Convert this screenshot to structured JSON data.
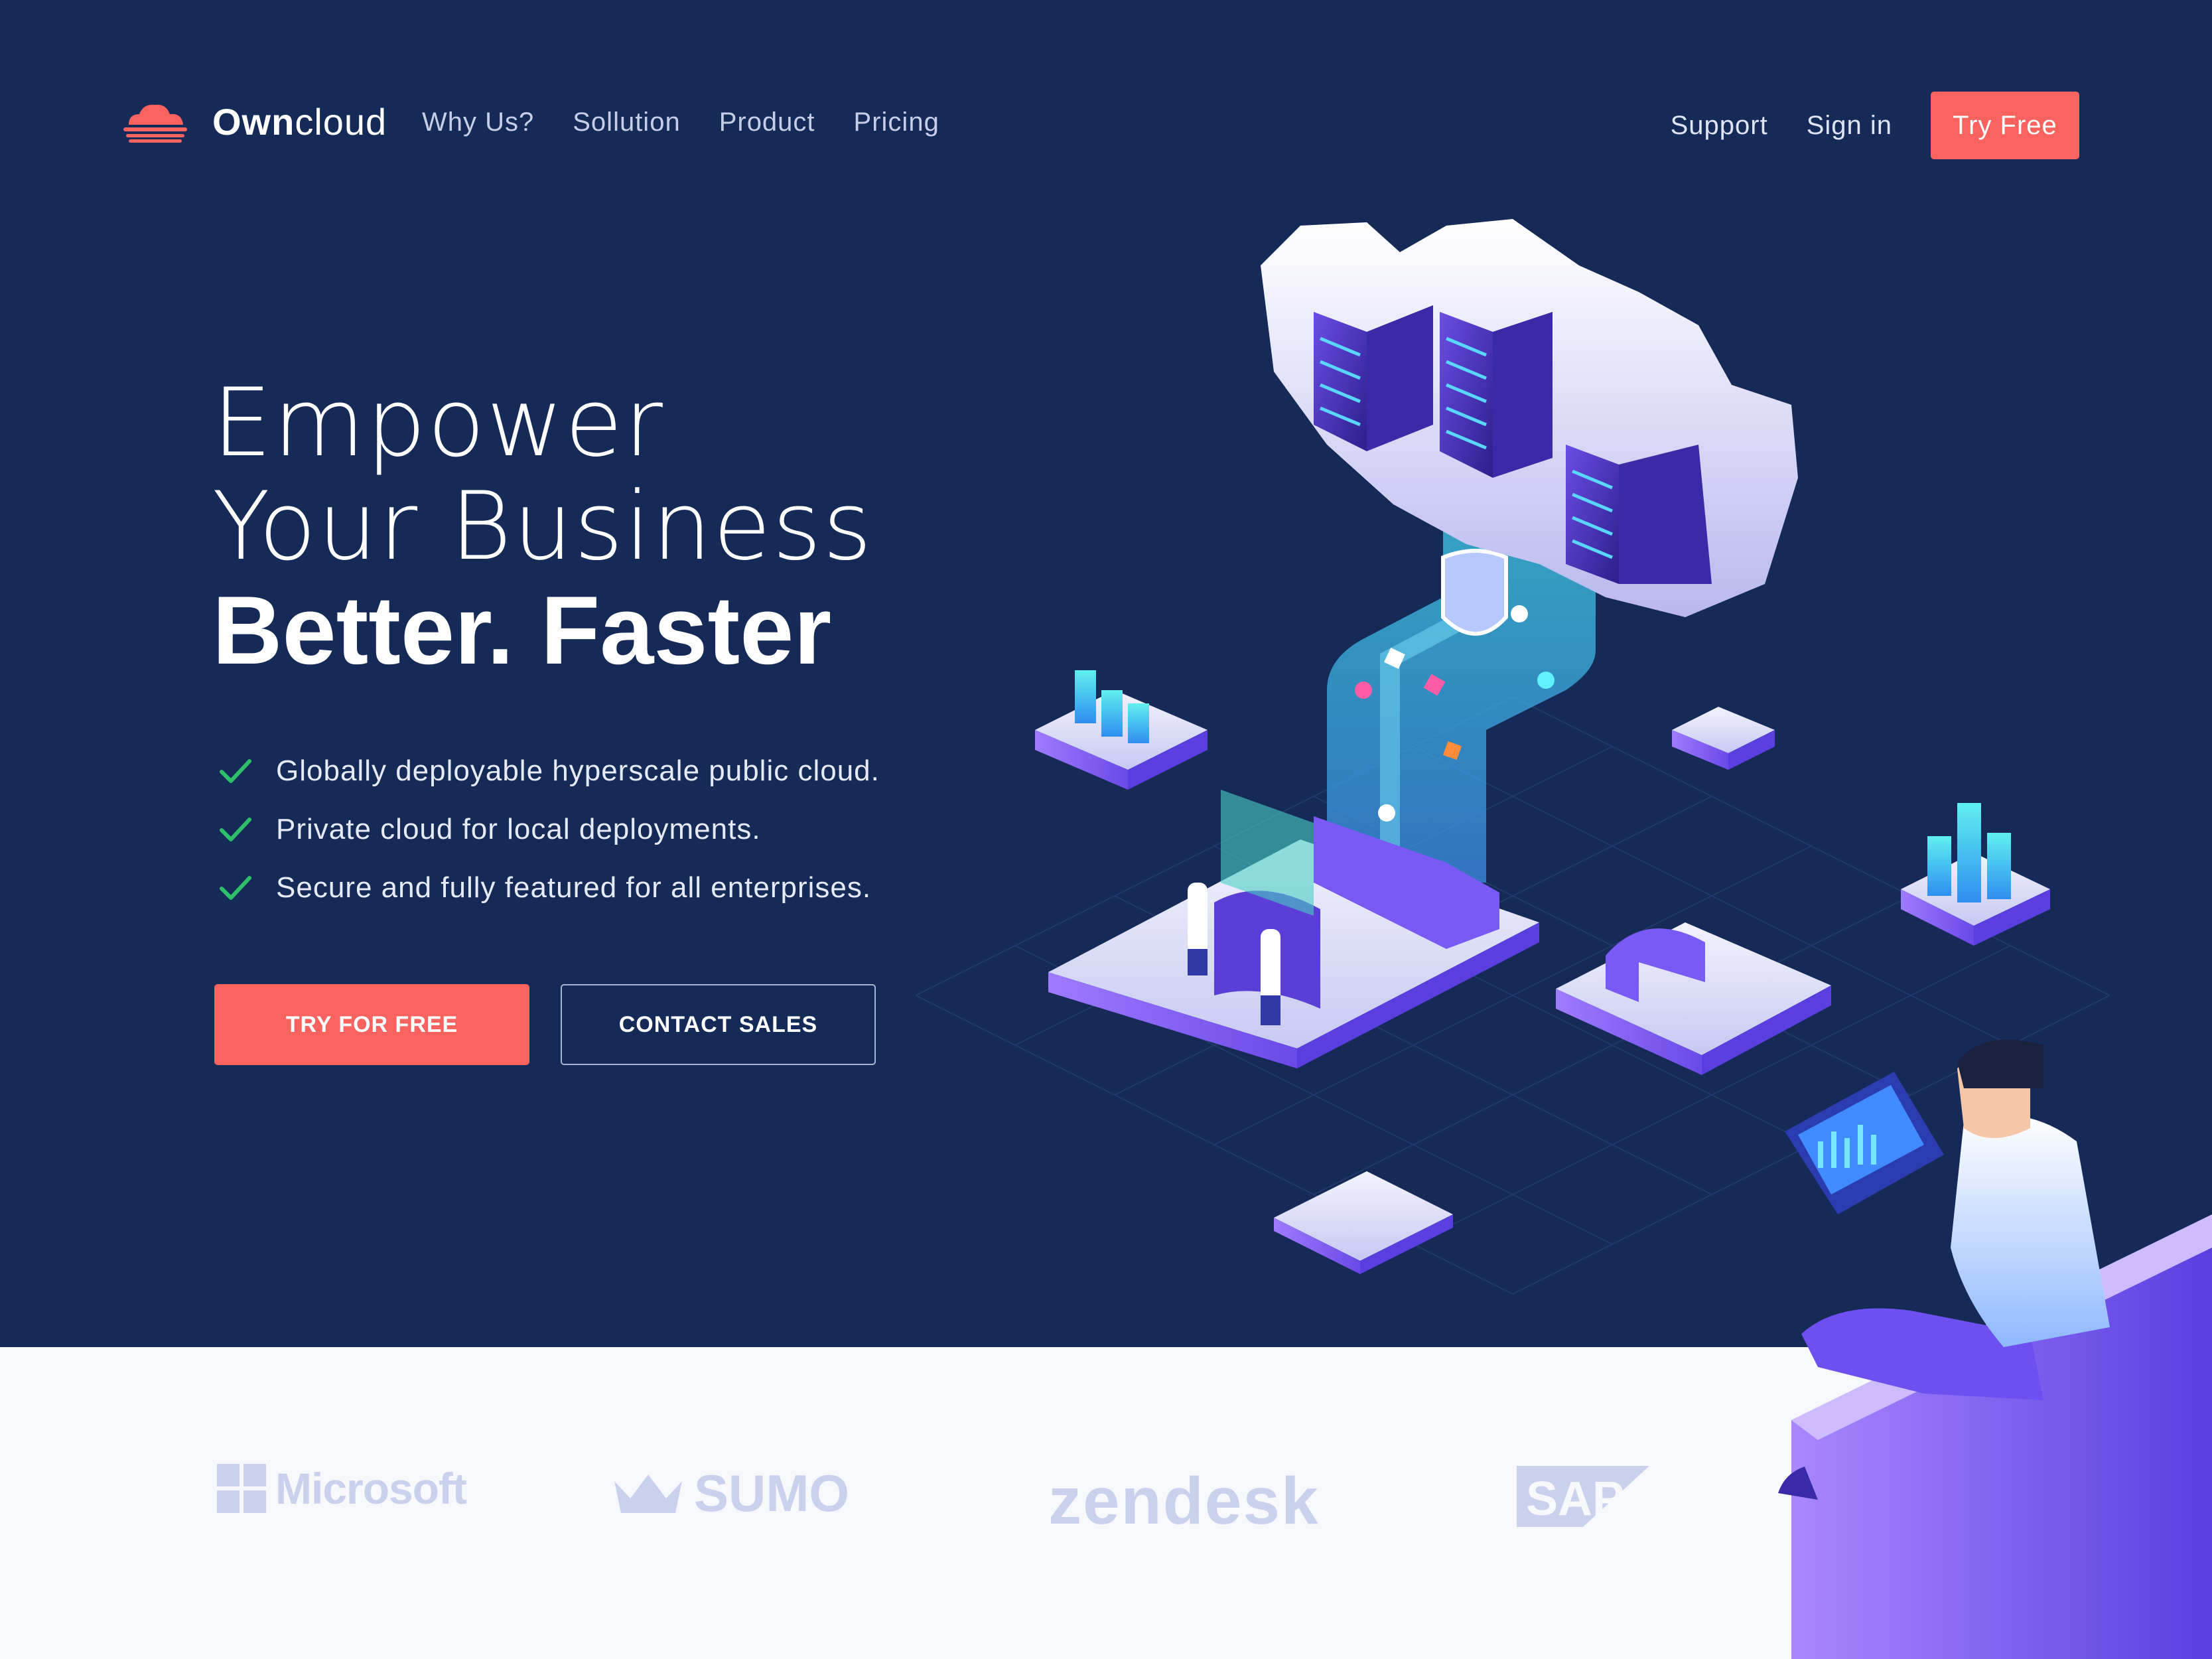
{
  "nav": {
    "brand_bold": "Own",
    "brand_regular": "cloud",
    "links": [
      "Why Us?",
      "Sollution",
      "Product",
      "Pricing"
    ],
    "support": "Support",
    "sign_in": "Sign in",
    "try_free": "Try Free"
  },
  "hero": {
    "headline_line1": "Empower",
    "headline_line2": "Your Business",
    "headline_line3": "Better. Faster",
    "features": [
      "Globally deployable hyperscale public cloud.",
      "Private cloud for local deployments.",
      "Secure and fully featured for all enterprises."
    ],
    "cta_primary": "TRY FOR FREE",
    "cta_secondary": "CONTACT SALES"
  },
  "logos": {
    "microsoft": "Microsoft",
    "sumo": "SUMO",
    "zendesk": "zendesk",
    "sap": "SAP"
  },
  "colors": {
    "hero_bg": "#162a58",
    "accent": "#f8635f",
    "check": "#2fbf6a",
    "logo_gray": "#c9d1ed",
    "footer_bg": "#f7f8fc"
  }
}
